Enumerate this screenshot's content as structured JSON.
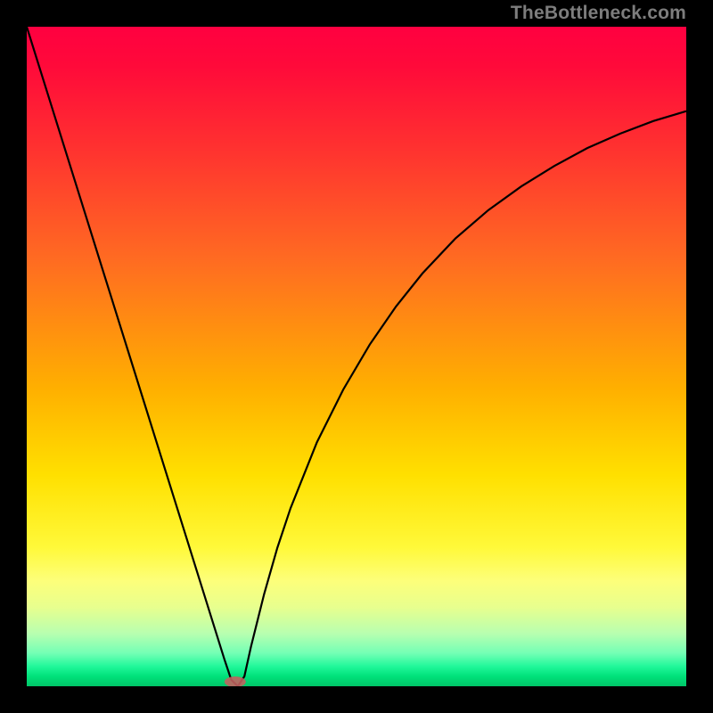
{
  "watermark": "TheBottleneck.com",
  "chart_data": {
    "type": "line",
    "title": "",
    "xlabel": "",
    "ylabel": "",
    "xlim": [
      0,
      100
    ],
    "ylim": [
      0,
      100
    ],
    "series": [
      {
        "name": "bottleneck-curve",
        "x": [
          0,
          4,
          8,
          12,
          16,
          20,
          24,
          26,
          28,
          30,
          31,
          32,
          33,
          34,
          36,
          38,
          40,
          44,
          48,
          52,
          56,
          60,
          65,
          70,
          75,
          80,
          85,
          90,
          95,
          100
        ],
        "y": [
          100,
          87.2,
          74.4,
          61.6,
          48.8,
          36.0,
          23.2,
          16.8,
          10.4,
          4.0,
          1.0,
          0.0,
          1.5,
          6.0,
          14.0,
          21.0,
          27.0,
          37.0,
          45.0,
          51.8,
          57.6,
          62.6,
          67.9,
          72.2,
          75.8,
          78.9,
          81.6,
          83.8,
          85.7,
          87.2
        ]
      }
    ],
    "annotations": [
      {
        "name": "min-blob",
        "x": 31.6,
        "y": 0.6,
        "shape": "ellipse"
      }
    ],
    "background_gradient": {
      "direction": "vertical",
      "stops": [
        {
          "pos": 0.0,
          "color": "#ff0040"
        },
        {
          "pos": 0.18,
          "color": "#ff3030"
        },
        {
          "pos": 0.55,
          "color": "#ffb000"
        },
        {
          "pos": 0.79,
          "color": "#fff93a"
        },
        {
          "pos": 0.92,
          "color": "#b8ffb0"
        },
        {
          "pos": 1.0,
          "color": "#00c668"
        }
      ]
    }
  }
}
